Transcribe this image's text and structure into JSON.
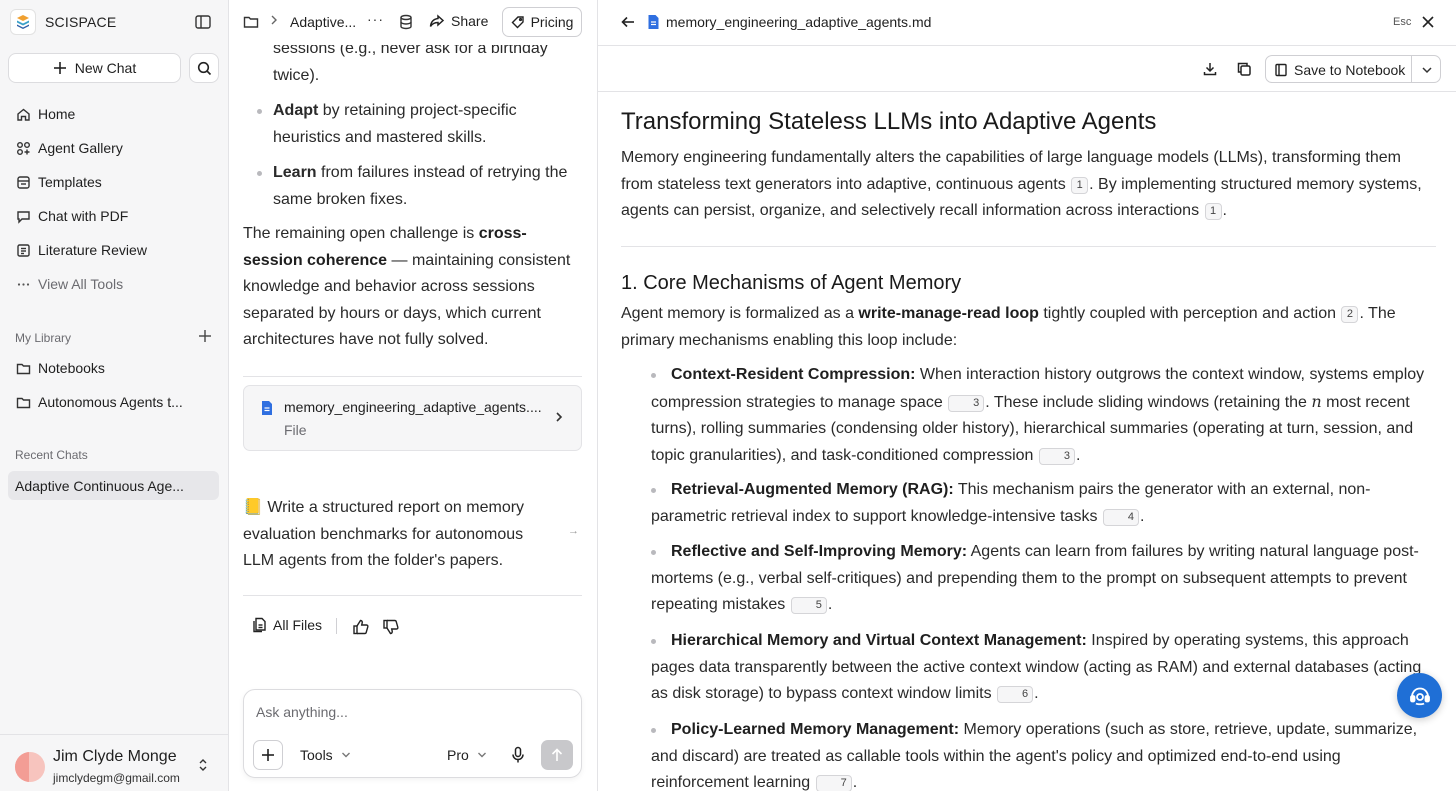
{
  "app": {
    "brand": "SCISPACE",
    "accent_color": "#1f6fd6"
  },
  "sidebar": {
    "new_chat_label": "New Chat",
    "nav": [
      {
        "label": "Home",
        "icon": "home-icon"
      },
      {
        "label": "Agent Gallery",
        "icon": "agent-gallery-icon"
      },
      {
        "label": "Templates",
        "icon": "templates-icon"
      },
      {
        "label": "Chat with PDF",
        "icon": "chat-icon"
      },
      {
        "label": "Literature Review",
        "icon": "literature-review-icon"
      },
      {
        "label": "View All Tools",
        "icon": "more-dots-icon"
      }
    ],
    "library_label": "My Library",
    "library_items": [
      {
        "label": "Notebooks",
        "icon": "folder-icon"
      },
      {
        "label": "Autonomous Agents t...",
        "icon": "folder-icon"
      }
    ],
    "recent_label": "Recent Chats",
    "recent_chats": [
      "Adaptive Continuous Age..."
    ],
    "user": {
      "name": "Jim Clyde Monge",
      "email": "jimclydegm@gmail.com"
    }
  },
  "chat": {
    "header": {
      "title": "Adaptive...",
      "more": "···",
      "share_label": "Share",
      "pricing_label": "Pricing"
    },
    "top_line": "sessions (e.g., never ask for a birthday twice).",
    "bullets": [
      {
        "bold": "Adapt",
        "text": " by retaining project-specific heuristics and mastered skills."
      },
      {
        "bold": "Learn",
        "text": " from failures instead of retrying the same broken fixes."
      }
    ],
    "closing": {
      "pre": "The remaining open challenge is ",
      "bold": "cross-session coherence",
      "post": " — maintaining consistent knowledge and behavior across sessions separated by hours or days, which current architectures have not fully solved."
    },
    "file_card": {
      "name": "memory_engineering_adaptive_agents....",
      "type": "File"
    },
    "followup": "📒 Write a structured report on memory evaluation benchmarks for autonomous LLM agents from the folder's papers.",
    "followup_arrow": "→",
    "actions": {
      "all_files_label": "All Files"
    },
    "composer": {
      "placeholder": "Ask anything...",
      "tools_label": "Tools",
      "mode_label": "Pro"
    }
  },
  "document": {
    "filename": "memory_engineering_adaptive_agents.md",
    "esc_label": "Esc",
    "save_label": "Save to Notebook",
    "title": "Transforming Stateless LLMs into Adaptive Agents",
    "intro": {
      "p1": "Memory engineering fundamentally alters the capabilities of large language models (LLMs), transforming them from stateless text generators into adaptive, continuous agents ",
      "c1": "1",
      "p2": ". By implementing structured memory systems, agents can persist, organize, and selectively recall information across interactions ",
      "c2": "1",
      "p3": "."
    },
    "section_title": "1. Core Mechanisms of Agent Memory",
    "section_intro": {
      "p1": "Agent memory is formalized as a ",
      "bold": "write-manage-read loop",
      "p2": " tightly coupled with perception and action ",
      "c1": "2",
      "p3": ". The primary mechanisms enabling this loop include:"
    },
    "items": [
      {
        "bold": "Context-Resident Compression:",
        "t1": " When interaction history outgrows the context window, systems employ compression strategies to manage space ",
        "c1": "3",
        "t2": ". These include sliding windows (retaining the ",
        "var": "n",
        "t3": " most recent turns), rolling summaries (condensing older history), hierarchical summaries (operating at turn, session, and topic granularities), and task-conditioned compression ",
        "c2": "3",
        "t4": "."
      },
      {
        "bold": "Retrieval-Augmented Memory (RAG):",
        "t1": " This mechanism pairs the generator with an external, non-parametric retrieval index to support knowledge-intensive tasks ",
        "c1": "4",
        "t2": "."
      },
      {
        "bold": "Reflective and Self-Improving Memory:",
        "t1": " Agents can learn from failures by writing natural language post-mortems (e.g., verbal self-critiques) and prepending them to the prompt on subsequent attempts to prevent repeating mistakes ",
        "c1": "5",
        "t2": "."
      },
      {
        "bold": "Hierarchical Memory and Virtual Context Management:",
        "t1": " Inspired by operating systems, this approach pages data transparently between the active context window (acting as RAM) and external databases (acting as disk storage) to bypass context window limits ",
        "c1": "6",
        "t2": "."
      },
      {
        "bold": "Policy-Learned Memory Management:",
        "t1": " Memory operations (such as store, retrieve, update, summarize, and discard) are treated as callable tools within the agent's policy and optimized end-to-end using reinforcement learning ",
        "c1": "7",
        "t2": "."
      }
    ]
  }
}
